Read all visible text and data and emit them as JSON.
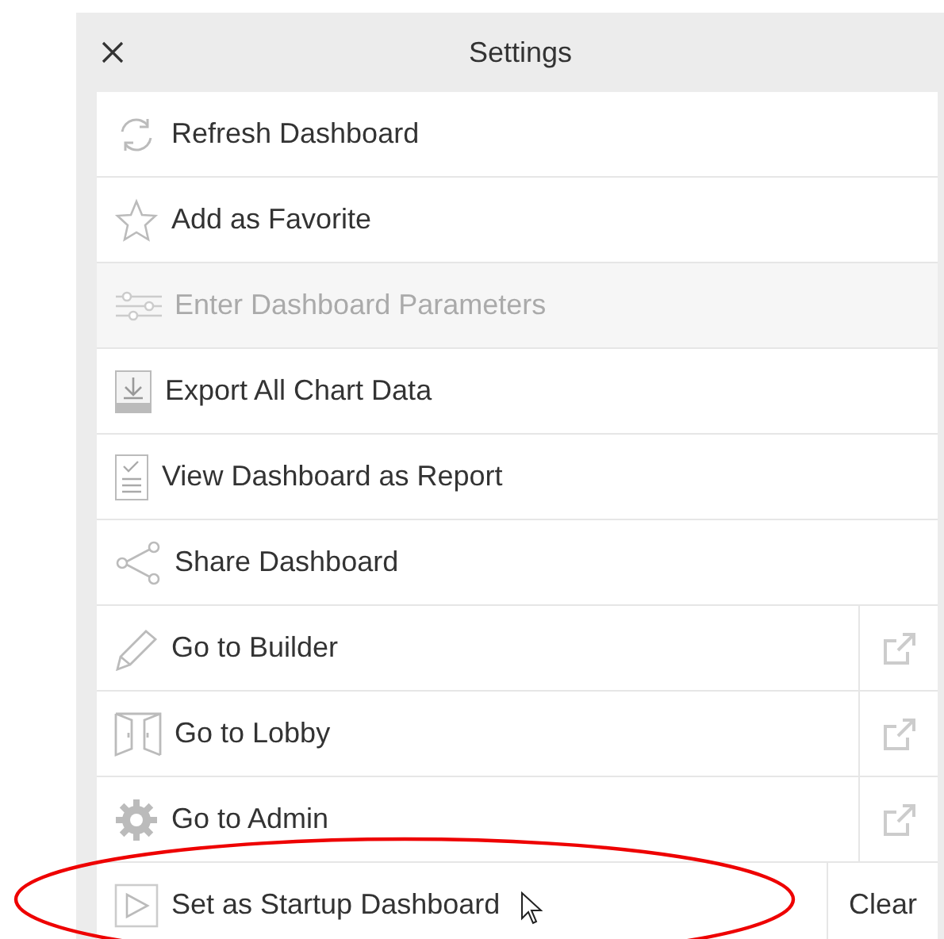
{
  "header": {
    "title": "Settings"
  },
  "items": [
    {
      "kind": "plain",
      "label": "Refresh Dashboard",
      "disabled": false
    },
    {
      "kind": "plain",
      "label": "Add as Favorite",
      "disabled": false
    },
    {
      "kind": "plain",
      "label": "Enter Dashboard Parameters",
      "disabled": true
    },
    {
      "kind": "plain",
      "label": "Export All Chart Data",
      "disabled": false
    },
    {
      "kind": "plain",
      "label": "View Dashboard as Report",
      "disabled": false
    },
    {
      "kind": "plain",
      "label": "Share Dashboard",
      "disabled": false
    },
    {
      "kind": "external",
      "label": "Go to Builder",
      "disabled": false
    },
    {
      "kind": "external",
      "label": "Go to Lobby",
      "disabled": false
    },
    {
      "kind": "external",
      "label": "Go to Admin",
      "disabled": false
    },
    {
      "kind": "clear",
      "label": "Set as Startup Dashboard",
      "disabled": false,
      "action": "Clear"
    }
  ]
}
